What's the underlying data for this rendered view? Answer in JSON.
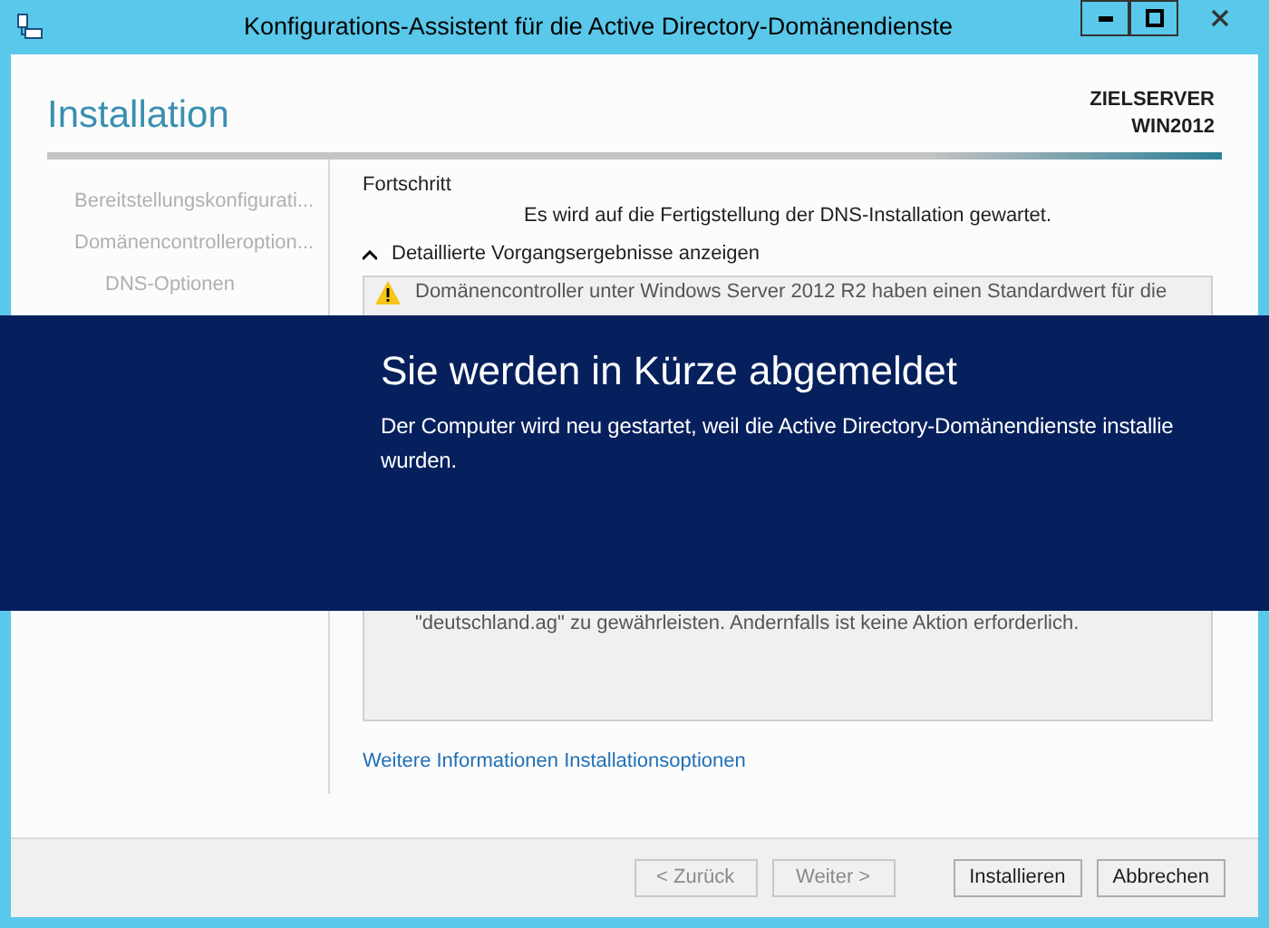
{
  "window": {
    "title": "Konfigurations-Assistent für die Active Directory-Domänendienste"
  },
  "header": {
    "title": "Installation",
    "server_label": "ZIELSERVER",
    "server_name": "WIN2012"
  },
  "sidebar": {
    "items": [
      {
        "label": "Bereitstellungskonfigurati..."
      },
      {
        "label": "Domänencontrolleroption...",
        "children": [
          {
            "label": "DNS-Optionen"
          }
        ]
      }
    ]
  },
  "progress": {
    "heading": "Fortschritt",
    "status": "Es wird auf die Fertigstellung der DNS-Installation gewartet.",
    "details_toggle": {
      "label": "Detaillierte Vorgangsergebnisse anzeigen",
      "expanded": true
    },
    "details": [
      {
        "kind": "warning",
        "text": "Domänencontroller unter Windows Server 2012 R2 haben einen Standardwert für die"
      },
      {
        "kind": "text",
        "text": "\"deutschland.ag\" zu gewährleisten. Andernfalls ist keine Aktion erforderlich."
      }
    ]
  },
  "more_info_link": "Weitere Informationen Installationsoptionen",
  "buttons": [
    {
      "label": "< Zurück",
      "disabled": true
    },
    {
      "label": "Weiter >",
      "disabled": true
    },
    {
      "label": "Installieren",
      "disabled": false
    },
    {
      "label": "Abbrechen",
      "disabled": false
    }
  ],
  "notification": {
    "title": "Sie werden in Kürze abgemeldet",
    "message_lines": [
      "Der Computer wird neu gestartet, weil die Active Directory-Domänendienste installie",
      "wurden."
    ]
  }
}
